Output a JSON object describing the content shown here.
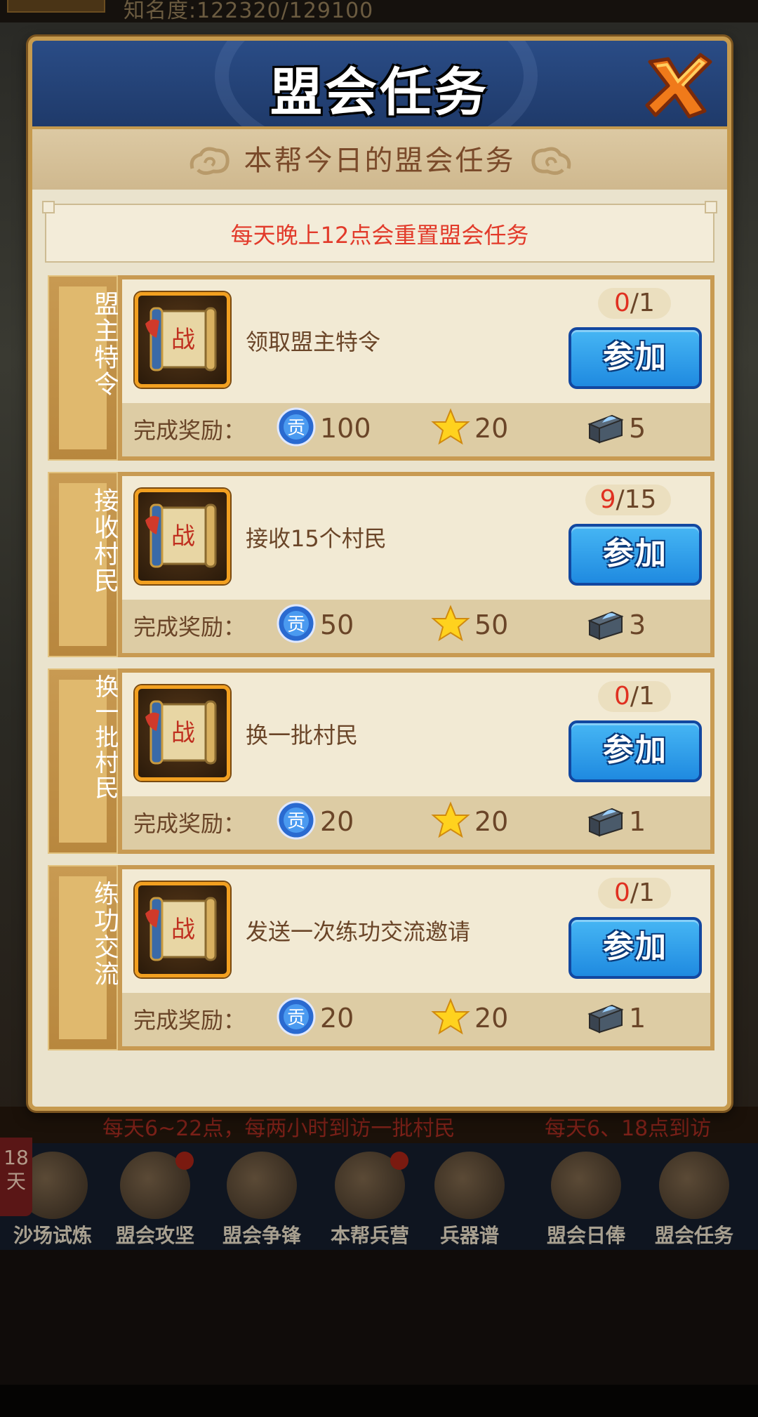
{
  "background": {
    "top_status": "知名度:122320/129100",
    "notice_left": "每天6~22点，每两小时到访一批村民",
    "notice_right": "每天6、18点到访",
    "day_badge": "18天",
    "dock_items": [
      {
        "label": "沙场试炼",
        "icon": "arena-icon",
        "dot": false
      },
      {
        "label": "盟会攻坚",
        "icon": "siege-icon",
        "dot": true
      },
      {
        "label": "盟会争锋",
        "icon": "contest-icon",
        "dot": false
      },
      {
        "label": "本帮兵营",
        "icon": "barracks-icon",
        "dot": true
      },
      {
        "label": "兵器谱",
        "icon": "weapon-book-icon",
        "dot": false
      },
      {
        "label": "盟会日俸",
        "icon": "salary-icon",
        "dot": false
      },
      {
        "label": "盟会任务",
        "icon": "task-icon",
        "dot": false
      }
    ]
  },
  "dialog": {
    "title": "盟会任务",
    "subtitle": "本帮今日的盟会任务",
    "reset_notice": "每天晚上12点会重置盟会任务",
    "reward_label": "完成奖励：",
    "join_label": "参加",
    "colors": {
      "progress_current": "#e03020",
      "button_blue": "#1f8ae0",
      "panel_gold": "#c89a52"
    },
    "tasks": [
      {
        "tab": "盟主特令",
        "desc": "领取盟主特令",
        "progress_current": "0",
        "progress_total": "/1",
        "reward_contribution": "100",
        "reward_star": "20",
        "reward_chest": "5"
      },
      {
        "tab": "接收村民",
        "desc": "接收15个村民",
        "progress_current": "9",
        "progress_total": "/15",
        "reward_contribution": "50",
        "reward_star": "50",
        "reward_chest": "3"
      },
      {
        "tab": "换一批村民",
        "desc": "换一批村民",
        "progress_current": "0",
        "progress_total": "/1",
        "reward_contribution": "20",
        "reward_star": "20",
        "reward_chest": "1"
      },
      {
        "tab": "练功交流",
        "desc": "发送一次练功交流邀请",
        "progress_current": "0",
        "progress_total": "/1",
        "reward_contribution": "20",
        "reward_star": "20",
        "reward_chest": "1"
      }
    ]
  }
}
